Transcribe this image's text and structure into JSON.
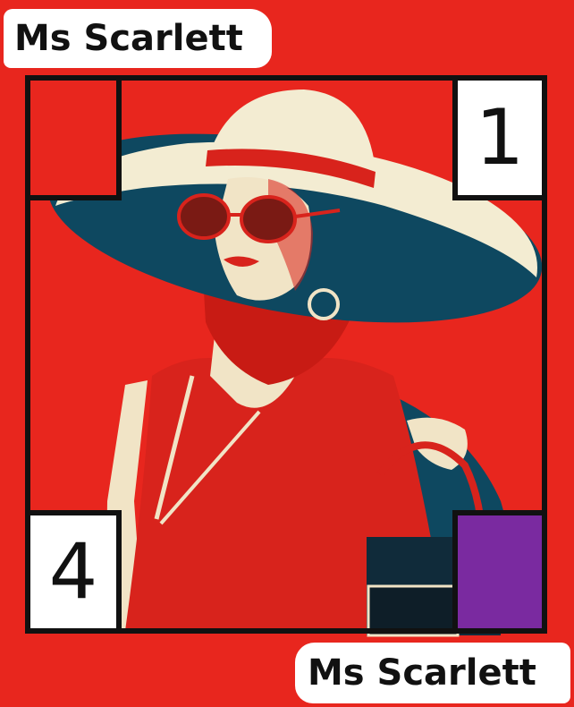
{
  "card": {
    "name_top": "Ms Scarlett",
    "name_bottom": "Ms Scarlett",
    "number_top_right": "1",
    "number_bottom_left": "4",
    "colors": {
      "background": "#e8261e",
      "swatch_top_left": "#e8261e",
      "swatch_bottom_right": "#7a2aa0",
      "hat": "#f3ecd2",
      "hat_brim_under": "#0e4860",
      "hat_band": "#d8231c",
      "skin": "#f1e4c6",
      "hair": "#c81b14"
    },
    "icons": [
      "woman-illustration-icon",
      "handbag-icon",
      "sunglasses-icon",
      "hat-icon"
    ]
  }
}
